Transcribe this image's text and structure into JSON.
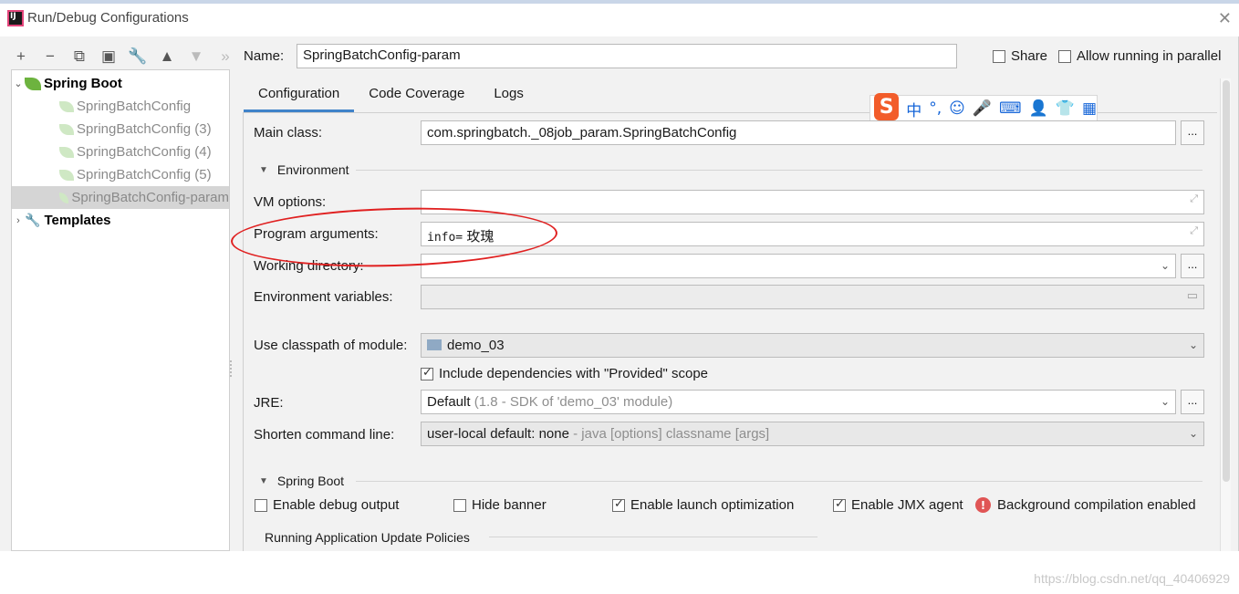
{
  "window": {
    "title": "Run/Debug Configurations"
  },
  "toolbar": {
    "add": "+",
    "remove": "−",
    "copy": "⧉",
    "save": "▣",
    "edit": "🔧",
    "up": "▲",
    "down": "▼",
    "more": "»"
  },
  "tree": {
    "group": "Spring Boot",
    "items": [
      "SpringBatchConfig",
      "SpringBatchConfig (3)",
      "SpringBatchConfig (4)",
      "SpringBatchConfig (5)",
      "SpringBatchConfig-param"
    ],
    "templates": "Templates"
  },
  "header": {
    "name_label": "Name:",
    "name_value": "SpringBatchConfig-param",
    "share_label": "Share",
    "allow_parallel_label": "Allow running in parallel"
  },
  "tabs": [
    "Configuration",
    "Code Coverage",
    "Logs"
  ],
  "ime_toolbar": {
    "logo": "S",
    "lang": "中",
    "punct": "°,",
    "emoji": "☺",
    "mic": "🎤",
    "keyboard": "⌨",
    "user": "👤",
    "shirt": "👕",
    "grid": "▦"
  },
  "form": {
    "main_class_label": "Main class:",
    "main_class_value": "com.springbatch._08job_param.SpringBatchConfig",
    "environment_section": "Environment",
    "vm_options_label": "VM options:",
    "vm_options_value": "",
    "program_args_label": "Program arguments:",
    "program_args_value_ascii": "info=",
    "program_args_value_cjk": "玫瑰",
    "working_dir_label": "Working directory:",
    "working_dir_value": "",
    "env_vars_label": "Environment variables:",
    "env_vars_value": "",
    "classpath_label": "Use classpath of module:",
    "classpath_value": "demo_03",
    "include_provided_label": "Include dependencies with \"Provided\" scope",
    "jre_label": "JRE:",
    "jre_value": "Default",
    "jre_hint": "(1.8 - SDK of 'demo_03' module)",
    "shorten_label": "Shorten command line:",
    "shorten_value": "user-local default: none",
    "shorten_hint": "- java [options] classname [args]",
    "spring_boot_section": "Spring Boot",
    "debug_output_label": "Enable debug output",
    "hide_banner_label": "Hide banner",
    "launch_opt_label": "Enable launch optimization",
    "jmx_agent_label": "Enable JMX agent",
    "bg_compilation_label": "Background compilation enabled",
    "update_policies_label": "Running Application Update Policies"
  },
  "checkboxes": {
    "share": false,
    "allow_parallel": false,
    "include_provided": true,
    "debug_output": false,
    "hide_banner": false,
    "launch_opt": true,
    "jmx_agent": true
  },
  "watermark": "https://blog.csdn.net/qq_40406929",
  "colors": {
    "tab_active": "#4083c9",
    "annotation": "#e02020",
    "spring_green": "#6db33f",
    "ime_orange": "#f25c2a"
  }
}
